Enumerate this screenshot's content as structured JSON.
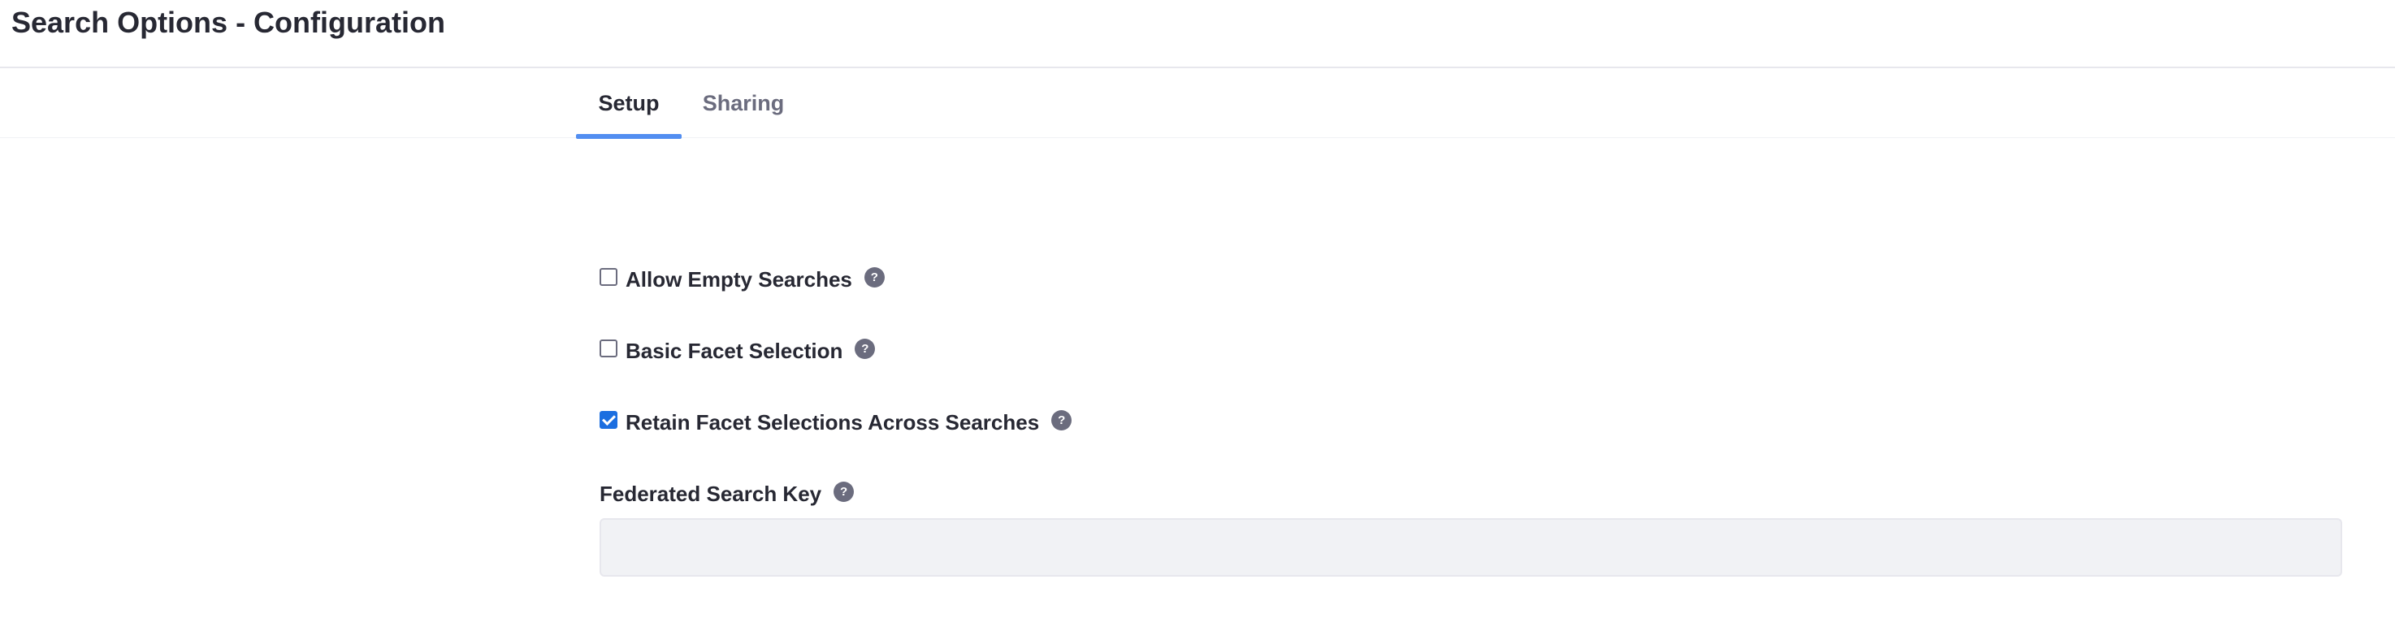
{
  "header": {
    "title": "Search Options - Configuration"
  },
  "tabs": [
    {
      "label": "Setup",
      "active": true
    },
    {
      "label": "Sharing",
      "active": false
    }
  ],
  "form": {
    "fields": [
      {
        "label": "Allow Empty Searches",
        "type": "checkbox",
        "checked": false,
        "help_icon": "question-icon"
      },
      {
        "label": "Basic Facet Selection",
        "type": "checkbox",
        "checked": false,
        "help_icon": "question-icon"
      },
      {
        "label": "Retain Facet Selections Across Searches",
        "type": "checkbox",
        "checked": true,
        "help_icon": "question-icon"
      }
    ],
    "federated_search_key": {
      "label": "Federated Search Key",
      "value": "",
      "placeholder": "",
      "help_icon": "question-icon"
    },
    "help_glyph": "?"
  },
  "colors": {
    "accent": "#528ef1",
    "checkbox_checked": "#1b6ee0",
    "text_primary": "#272833",
    "text_secondary": "#6b6c7e",
    "input_bg": "#f1f2f5"
  }
}
